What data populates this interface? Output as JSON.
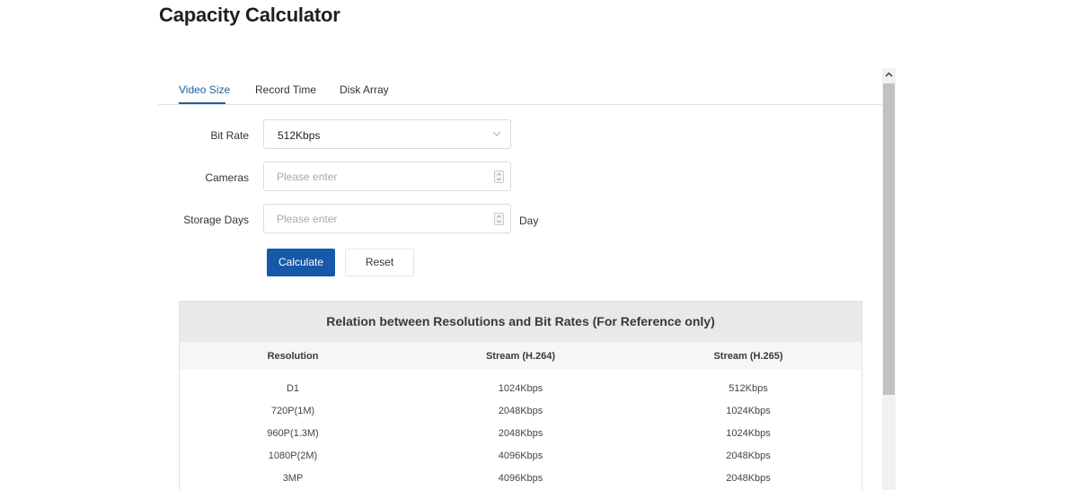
{
  "page": {
    "title": "Capacity Calculator"
  },
  "tabs": [
    {
      "label": "Video Size",
      "active": true
    },
    {
      "label": "Record Time",
      "active": false
    },
    {
      "label": "Disk Array",
      "active": false
    }
  ],
  "form": {
    "bit_rate": {
      "label": "Bit Rate",
      "value": "512Kbps"
    },
    "cameras": {
      "label": "Cameras",
      "placeholder": "Please enter"
    },
    "storage_days": {
      "label": "Storage Days",
      "placeholder": "Please enter",
      "unit": "Day"
    },
    "calculate_label": "Calculate",
    "reset_label": "Reset"
  },
  "reference": {
    "title": "Relation between Resolutions and Bit Rates (For Reference only)",
    "columns": [
      "Resolution",
      "Stream (H.264)",
      "Stream (H.265)"
    ],
    "rows": [
      [
        "D1",
        "1024Kbps",
        "512Kbps"
      ],
      [
        "720P(1M)",
        "2048Kbps",
        "1024Kbps"
      ],
      [
        "960P(1.3M)",
        "2048Kbps",
        "1024Kbps"
      ],
      [
        "1080P(2M)",
        "4096Kbps",
        "2048Kbps"
      ],
      [
        "3MP",
        "4096Kbps",
        "2048Kbps"
      ]
    ]
  },
  "colors": {
    "accent": "#1659a8",
    "active_tab": "#1f5f9f",
    "table_header_bg": "#e9e9e9"
  },
  "icons": {
    "select_arrow": "chevron-down-icon",
    "number_stepper": "stepper-icon",
    "scroll_up": "chevron-up-icon"
  }
}
